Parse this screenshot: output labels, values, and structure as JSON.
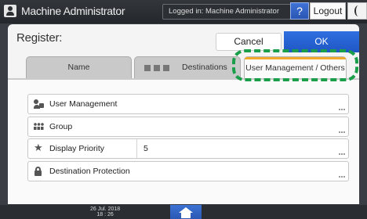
{
  "topbar": {
    "app_title": "Machine Administrator",
    "login_status": "Logged in: Machine Administrator",
    "help_label": "?",
    "logout_label": "Logout"
  },
  "dialog": {
    "title": "Register",
    "cancel_label": "Cancel",
    "ok_label": "OK"
  },
  "tabs": [
    {
      "label": "Name"
    },
    {
      "label": "Destinations"
    },
    {
      "label": "User Management / Others",
      "selected": true
    }
  ],
  "rows": [
    {
      "label": "User Management",
      "icon": "user-management-icon"
    },
    {
      "label": "Group",
      "icon": "group-icon"
    },
    {
      "label": "Display Priority",
      "icon": "star-icon",
      "value": "5"
    },
    {
      "label": "Destination Protection",
      "icon": "lock-icon"
    }
  ],
  "footer": {
    "date": "26 Jul. 2018",
    "time": "18 : 26"
  },
  "colors": {
    "accent_blue": "#2660d0",
    "tab_stripe": "#f0a929",
    "highlight": "#1b9e4a"
  }
}
